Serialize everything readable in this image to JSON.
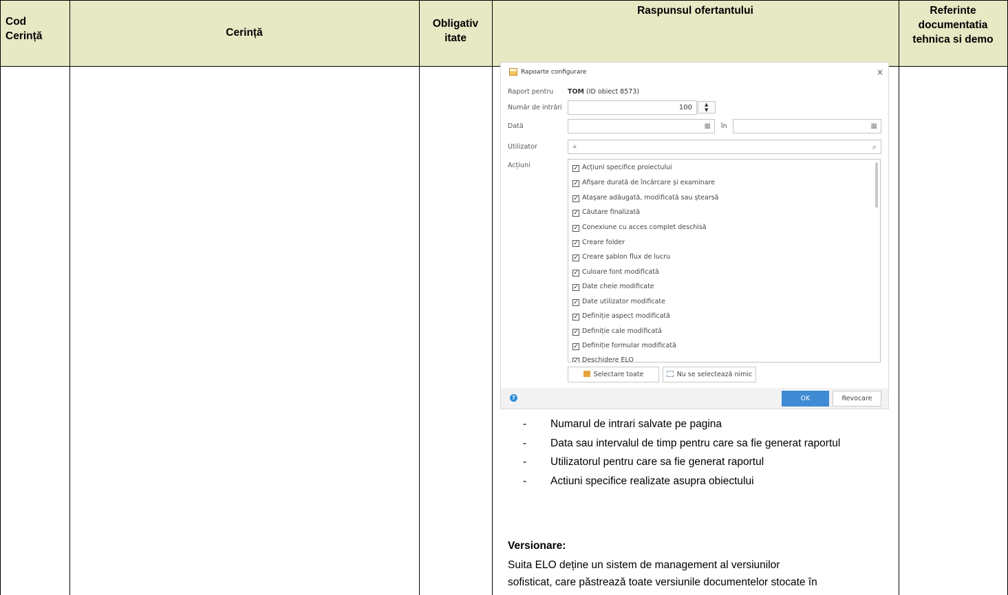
{
  "table": {
    "headers": {
      "cod": [
        "Cod",
        "Cerință"
      ],
      "cerinta": "Cerință",
      "obligativitate": [
        "Obligativ",
        "itate"
      ],
      "raspuns": "Raspunsul ofertantului",
      "referinte": [
        "Referinte",
        "documentatia",
        "tehnica si demo"
      ]
    },
    "header_bg": "#e7e8c4"
  },
  "dialog": {
    "title": "Rapoarte configurare",
    "close_glyph": "×",
    "raport_pentru_label": "Raport pentru",
    "raport_pentru_value_bold": "TOM",
    "raport_pentru_value": "(ID obiect 8573)",
    "numar_intrari_label": "Număr de intrări",
    "numar_intrari_value": "100",
    "data_label": "Dată",
    "in_label": "în",
    "utilizator_label": "Utilizator",
    "actiuni_label": "Acțiuni",
    "actions": [
      "Acțiuni specifice proiectului",
      "Afișare durată de încărcare și examinare",
      "Atașare adăugată, modificată sau ștearsă",
      "Căutare finalizată",
      "Conexiune cu acces complet deschisă",
      "Creare folder",
      "Creare șablon flux de lucru",
      "Culoare font modificată",
      "Date cheie modificate",
      "Date utilizator modificate",
      "Definiție aspect modificată",
      "Definiție cale modificată",
      "Definiție formular modificată",
      "Deschidere ELO"
    ],
    "select_all_label": "Selectare toate",
    "select_none_label": "Nu se selectează nimic",
    "ok_label": "OK",
    "cancel_label": "Revocare",
    "accent_color": "#3f8bd4"
  },
  "bullets": [
    "Numarul de intrari salvate pe pagina",
    "Data sau intervalul de timp pentru care sa fie generat raportul",
    "Utilizatorul pentru care sa fie generat raportul",
    "Actiuni specifice realizate asupra obiectului"
  ],
  "bullet_dash": "-",
  "versionare": {
    "heading": "Versionare:",
    "text_line1": "Suita ELO deține un sistem de management al versiunilor",
    "text_line2": "sofisticat, care păstrează toate versiunile documentelor stocate în"
  }
}
